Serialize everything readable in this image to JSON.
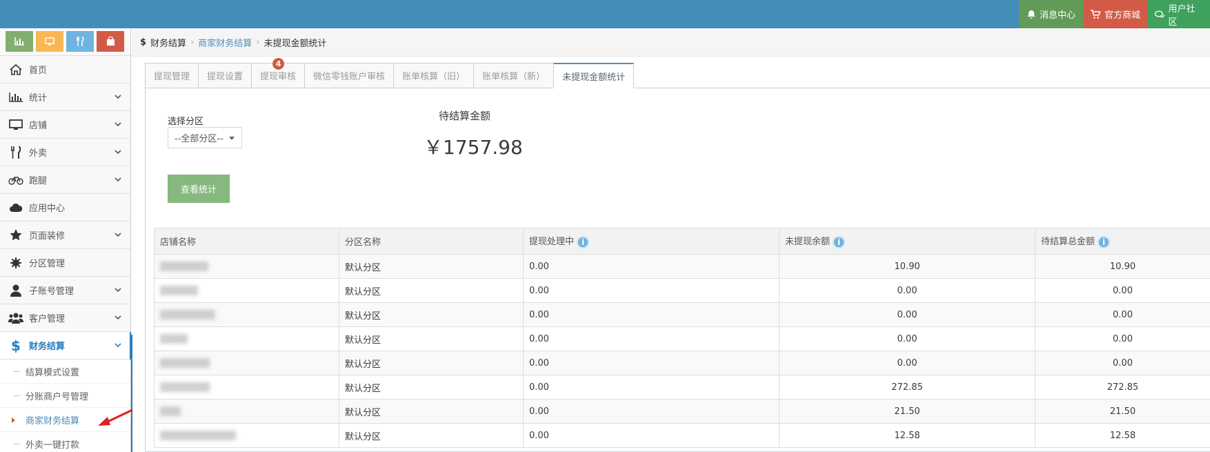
{
  "topbar": {
    "buttons": [
      {
        "label": "消息中心",
        "icon": "bell-icon"
      },
      {
        "label": "官方商城",
        "icon": "cart-icon"
      },
      {
        "label": "用户社区",
        "icon": "comments-icon"
      }
    ],
    "colors": {
      "bar": "#438eb9",
      "msg": "#629b58",
      "shop": "#d15b47",
      "community": "#3ea15c"
    }
  },
  "sidebar": {
    "shortcuts": [
      "chart-icon",
      "monitor-icon",
      "utensils-icon",
      "bag-icon"
    ],
    "items": [
      {
        "label": "首页",
        "icon": "home-icon"
      },
      {
        "label": "统计",
        "icon": "bar-chart-icon"
      },
      {
        "label": "店铺",
        "icon": "desktop-icon"
      },
      {
        "label": "外卖",
        "icon": "utensils-icon"
      },
      {
        "label": "跑腿",
        "icon": "bicycle-icon"
      },
      {
        "label": "应用中心",
        "icon": "cloud-icon"
      },
      {
        "label": "页面装修",
        "icon": "star-icon"
      },
      {
        "label": "分区管理",
        "icon": "gear-icon"
      },
      {
        "label": "子账号管理",
        "icon": "user-icon"
      },
      {
        "label": "客户管理",
        "icon": "users-icon"
      },
      {
        "label": "财务结算",
        "icon": "dollar-icon"
      }
    ],
    "sub_items": [
      "结算模式设置",
      "分账商户号管理",
      "商家财务结算",
      "外卖一键打款"
    ]
  },
  "breadcrumb": {
    "root": "财务结算",
    "mid": "商家财务结算",
    "current": "未提现金额统计"
  },
  "tabs": [
    {
      "label": "提现管理"
    },
    {
      "label": "提现设置"
    },
    {
      "label": "提现审核",
      "badge": "4"
    },
    {
      "label": "微信零钱账户审核"
    },
    {
      "label": "账单核算（旧）"
    },
    {
      "label": "账单核算（新）"
    },
    {
      "label": "未提现金额统计"
    }
  ],
  "filter": {
    "label": "选择分区",
    "selected": "--全部分区--"
  },
  "amount": {
    "title": "待结算金额",
    "value": "￥1757.98"
  },
  "view_button": "查看统计",
  "table": {
    "headers": [
      "店铺名称",
      "分区名称",
      "提现处理中",
      "未提现余额",
      "待结算总金额"
    ],
    "rows": [
      [
        "",
        "默认分区",
        "0.00",
        "10.90",
        "10.90"
      ],
      [
        "",
        "默认分区",
        "0.00",
        "0.00",
        "0.00"
      ],
      [
        "",
        "默认分区",
        "0.00",
        "0.00",
        "0.00"
      ],
      [
        "",
        "默认分区",
        "0.00",
        "0.00",
        "0.00"
      ],
      [
        "",
        "默认分区",
        "0.00",
        "0.00",
        "0.00"
      ],
      [
        "",
        "默认分区",
        "0.00",
        "272.85",
        "272.85"
      ],
      [
        "",
        "默认分区",
        "0.00",
        "21.50",
        "21.50"
      ],
      [
        "",
        "默认分区",
        "0.00",
        "12.58",
        "12.58"
      ]
    ]
  }
}
